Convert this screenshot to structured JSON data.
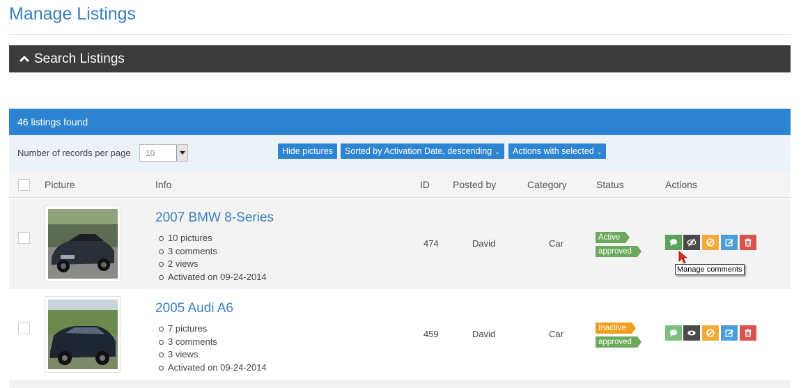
{
  "page": {
    "title": "Manage Listings"
  },
  "search": {
    "label": "Search Listings"
  },
  "results": {
    "count_text": "46 listings found"
  },
  "controls": {
    "records_label": "Number of records per page",
    "records_value": "10",
    "hide_pictures": "Hide pictures",
    "sort_label": "Sorted by Activation Date, descending",
    "actions_label": "Actions with selected"
  },
  "table": {
    "headers": {
      "picture": "Picture",
      "info": "Info",
      "id": "ID",
      "posted_by": "Posted by",
      "category": "Category",
      "status": "Status",
      "actions": "Actions"
    }
  },
  "listings": [
    {
      "title": "2007 BMW 8-Series",
      "details": [
        "10 pictures",
        "3 comments",
        "2 views",
        "Activated on 09-24-2014"
      ],
      "id": "474",
      "posted_by": "David",
      "category": "Car",
      "status": "Active",
      "approval": "approved"
    },
    {
      "title": "2005 Audi A6",
      "details": [
        "7 pictures",
        "3 comments",
        "3 views",
        "Activated on 09-24-2014"
      ],
      "id": "459",
      "posted_by": "David",
      "category": "Car",
      "status": "Inactive",
      "approval": "approved"
    }
  ],
  "tooltip": {
    "text": "Manage comments"
  },
  "colors": {
    "primary": "#2d84d3",
    "title": "#3a7fc1",
    "dark_bar": "#3c3c3c",
    "comment": "#5aa35a",
    "comment_faded": "#7cbf7a",
    "view": "#4a4a4a",
    "deactivate": "#f2ab3b",
    "edit": "#4a9fdb",
    "delete": "#d9534f",
    "tag_green": "#6aa85c",
    "tag_orange": "#f29e1d"
  },
  "icons": [
    "chevron-up-icon",
    "comment-icon",
    "eye-slash-icon",
    "eye-icon",
    "ban-icon",
    "edit-icon",
    "trash-icon",
    "mouse-cursor-icon"
  ]
}
